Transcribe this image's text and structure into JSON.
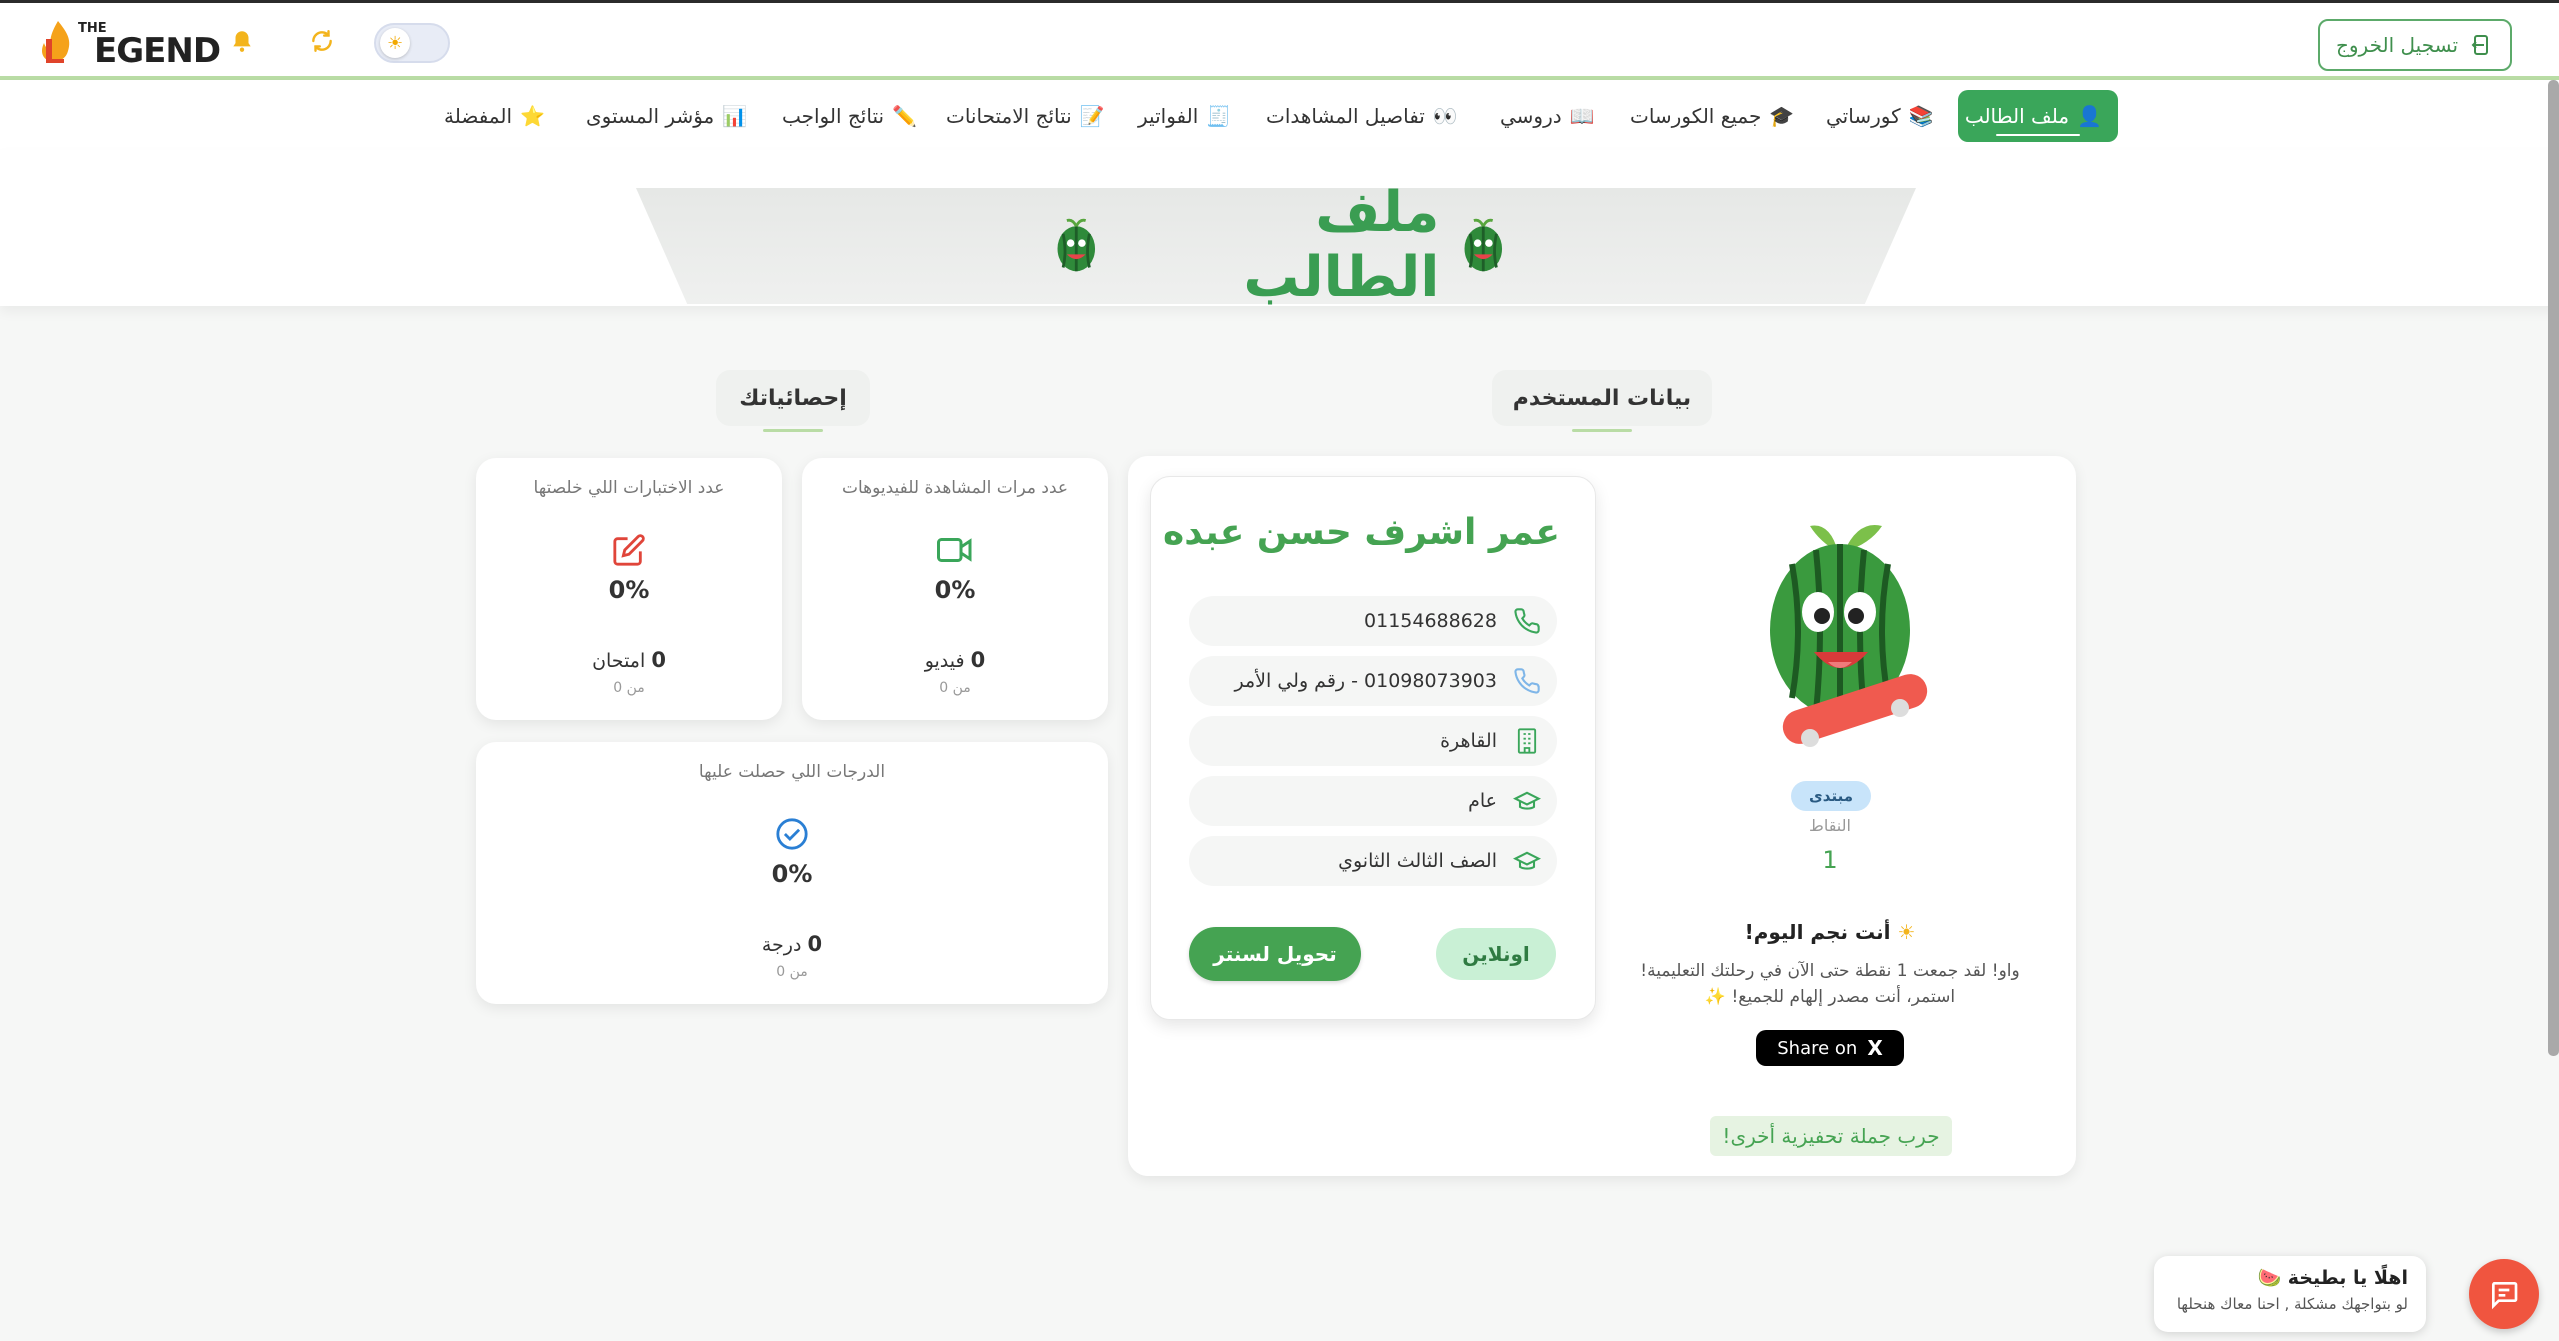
{
  "header": {
    "logo_the": "THE",
    "logo_text": "EGEND",
    "logout_label": "تسجيل الخروج"
  },
  "nav": {
    "items": [
      {
        "label": "ملف الطالب",
        "emoji": "👤"
      },
      {
        "label": "كورساتي",
        "emoji": "📚"
      },
      {
        "label": "جميع الكورسات",
        "emoji": "🎓"
      },
      {
        "label": "دروسي",
        "emoji": "📖"
      },
      {
        "label": "تفاصيل المشاهدات",
        "emoji": "👀"
      },
      {
        "label": "الفواتير",
        "emoji": "🧾"
      },
      {
        "label": "نتائج الامتحانات",
        "emoji": "📝"
      },
      {
        "label": "نتائج الواجب",
        "emoji": "✏️"
      },
      {
        "label": "مؤشر المستوى",
        "emoji": "📊"
      },
      {
        "label": "المفضلة",
        "emoji": "⭐"
      }
    ]
  },
  "hero": {
    "title": "ملف الطالب"
  },
  "sections": {
    "user_data": "بيانات المستخدم",
    "stats": "إحصائياتك"
  },
  "stats": {
    "videos": {
      "title": "عدد مرات المشاهدة للفيديوهات",
      "percent": "0%",
      "count": "0",
      "unit": "فيديو",
      "of": "من 0"
    },
    "exams": {
      "title": "عدد الاختبارات اللي خلصتها",
      "percent": "0%",
      "count": "0",
      "unit": "امتحان",
      "of": "من 0"
    },
    "grades": {
      "title": "الدرجات اللي حصلت عليها",
      "percent": "0%",
      "count": "0",
      "unit": "درجة",
      "of": "من 0"
    }
  },
  "user": {
    "name": "عمر اشرف حسن عبده",
    "phone": "01154688628",
    "parent_phone": "01098073903 - رقم ولي الأمر",
    "city": "القاهرة",
    "track": "عام",
    "grade": "الصف الثالث الثانوي",
    "btn_online": "اونلاين",
    "btn_center": "تحويل لسنتر"
  },
  "profile": {
    "level": "مبتدى",
    "points_label": "النقاط",
    "points_value": "1",
    "star_title": "أنت نجم اليوم!",
    "star_line1": "واو! لقد جمعت 1 نقطة حتى الآن في رحلتك التعليمية!",
    "star_line2": "استمر، أنت مصدر إلهام للجميع! ✨",
    "share_label": "Share on",
    "share_x": "X",
    "try_another": "جرب جملة تحفيزية أخرى!"
  },
  "chat": {
    "title": "اهلًا يا بطيخة 🍉",
    "subtitle": "لو بتواجهك مشكلة , احنا معاك هنحلها"
  },
  "colors": {
    "brand_green": "#45a352",
    "accent_orange": "#f0553f",
    "nav_active": "#3aa65a"
  }
}
